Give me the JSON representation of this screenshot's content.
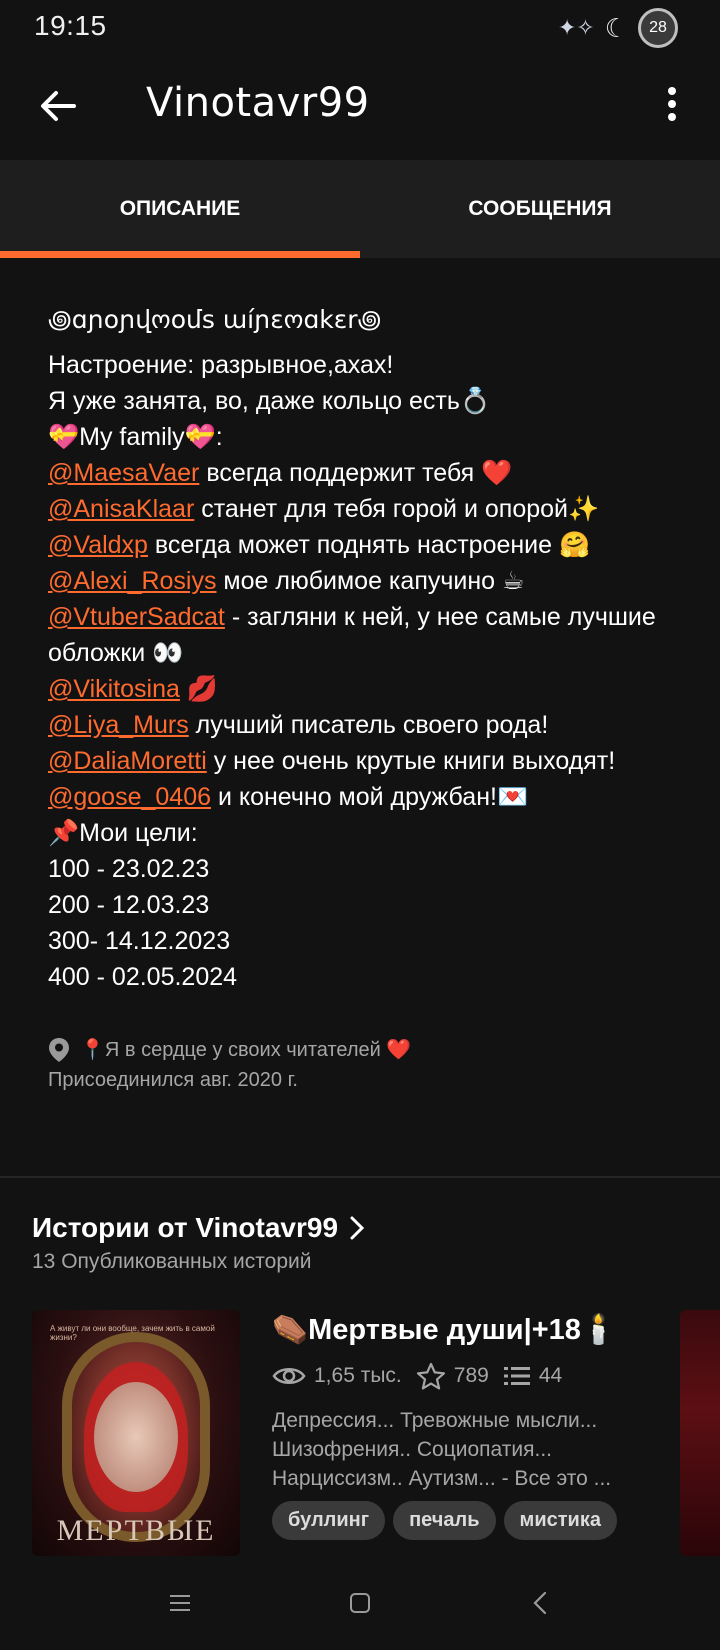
{
  "status": {
    "time": "19:15",
    "battery": "28"
  },
  "appbar": {
    "title": "Vinotavr99"
  },
  "tabs": [
    {
      "label": "ОПИСАНИЕ",
      "active": true
    },
    {
      "label": "СООБЩЕНИЯ",
      "active": false
    }
  ],
  "description": {
    "heading": "꩜ɑɲoɲվოoմs աíɲɛოɑkɛr꩜",
    "mood": "Настроение: разрывное,ахах!",
    "busy": "Я уже занята, во, даже кольцо есть💍",
    "family": "💝My family💝:",
    "mentions": [
      {
        "user": "@MaesaVaer",
        "text": " всегда поддержит тебя ❤️"
      },
      {
        "user": "@AnisaKlaar",
        "text": " станет для тебя горой и опорой✨"
      },
      {
        "user": "@Valdxp",
        "text": " всегда может поднять настроение 🤗"
      },
      {
        "user": "@Alexi_Rosiys",
        "text": " мое любимое капучино ☕"
      },
      {
        "user": "@VtuberSadcat",
        "text": " - загляни к ней, у нее самые лучшие обложки 👀"
      },
      {
        "user": "@Vikitosina",
        "text": " 💋"
      },
      {
        "user": "@Liya_Murs",
        "text": " лучший писатель своего рода!"
      },
      {
        "user": "@DaliaMoretti",
        "text": " у нее очень крутые книги выходят!"
      },
      {
        "user": "@goose_0406",
        "text": " и конечно мой дружбан!💌"
      }
    ],
    "goals_title": "📌Мои цели:",
    "goals": [
      "100 - 23.02.23",
      "200 - 12.03.23",
      "300- 14.12.2023",
      "400 - 02.05.2024"
    ]
  },
  "meta": {
    "location": "📍Я в сердце у своих читателей ❤️",
    "joined": "Присоединился авг. 2020 г."
  },
  "stories": {
    "title": "Истории от Vinotavr99",
    "count": "13 Опубликованных историй",
    "items": [
      {
        "title": "⚰️Мертвые души|+18🕯️",
        "views": "1,65 тыс.",
        "votes": "789",
        "parts": "44",
        "summary": [
          "Депрессия... Тревожные мысли...",
          "Шизофрения.. Социопатия...",
          "Нарциссизм.. Аутизм... - Все это ..."
        ],
        "tags": [
          "буллинг",
          "печаль",
          "мистика"
        ],
        "cover_title": "МЕРТВЫЕ",
        "cover_tagline": "А живут ли они вообще, зачем жить в самой жизни?"
      }
    ]
  },
  "colors": {
    "accent": "#ff6b2f",
    "background": "#121212",
    "tab_bg": "#1e1e1e"
  }
}
